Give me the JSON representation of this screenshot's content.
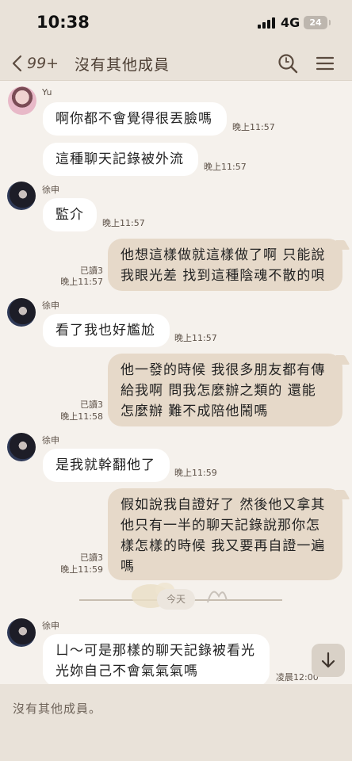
{
  "status": {
    "time": "10:38",
    "network": "4G",
    "battery": "24"
  },
  "nav": {
    "back_count": "99+",
    "title": "沒有其他成員"
  },
  "messages": {
    "m1": {
      "sender": "Yu",
      "lines": [
        "啊你都不會覺得很丟臉嗎"
      ],
      "time": "晚上11:57"
    },
    "m2": {
      "lines": [
        "這種聊天記錄被外流"
      ],
      "time": "晚上11:57"
    },
    "m3": {
      "sender": "徐申",
      "lines": [
        "監介"
      ],
      "time": "晚上11:57"
    },
    "m4": {
      "lines": [
        "他想這樣做就這樣做了啊 只能說",
        "我眼光差 找到這種陰魂不散的唄"
      ],
      "read": "已讀3",
      "time": "晚上11:57"
    },
    "m5": {
      "sender": "徐申",
      "lines": [
        "看了我也好尷尬"
      ],
      "time": "晚上11:57"
    },
    "m6": {
      "lines": [
        "他一發的時候 我很多朋友都有傳",
        "給我啊 問我怎麼辦之類的 還能",
        "怎麼辦 難不成陪他鬧嗎"
      ],
      "read": "已讀3",
      "time": "晚上11:58"
    },
    "m7": {
      "sender": "徐申",
      "lines": [
        "是我就幹翻他了"
      ],
      "time": "晚上11:59"
    },
    "m8": {
      "lines": [
        "假如說我自證好了 然後他又拿其",
        "他只有一半的聊天記錄說那你怎",
        "樣怎樣的時候 我又要再自證一遍",
        "嗎"
      ],
      "read": "已讀3",
      "time": "晚上11:59"
    },
    "m9": {
      "sender": "徐申",
      "lines": [
        "ㄩ～可是那樣的聊天記錄被看光",
        "光妳自己不會氣氣氣嗎"
      ],
      "time": "凌晨12:00"
    }
  },
  "date_divider": "今天",
  "input": {
    "text": "沒有其他成員。"
  },
  "icons": {
    "back": "chevron-left-icon",
    "search": "search-icon",
    "menu": "menu-icon",
    "scroll": "arrow-down-icon"
  },
  "colors": {
    "header": "#e9e2d9",
    "background": "#f5f1ec",
    "outgoing": "#e6d9c9",
    "incoming": "#ffffff"
  }
}
